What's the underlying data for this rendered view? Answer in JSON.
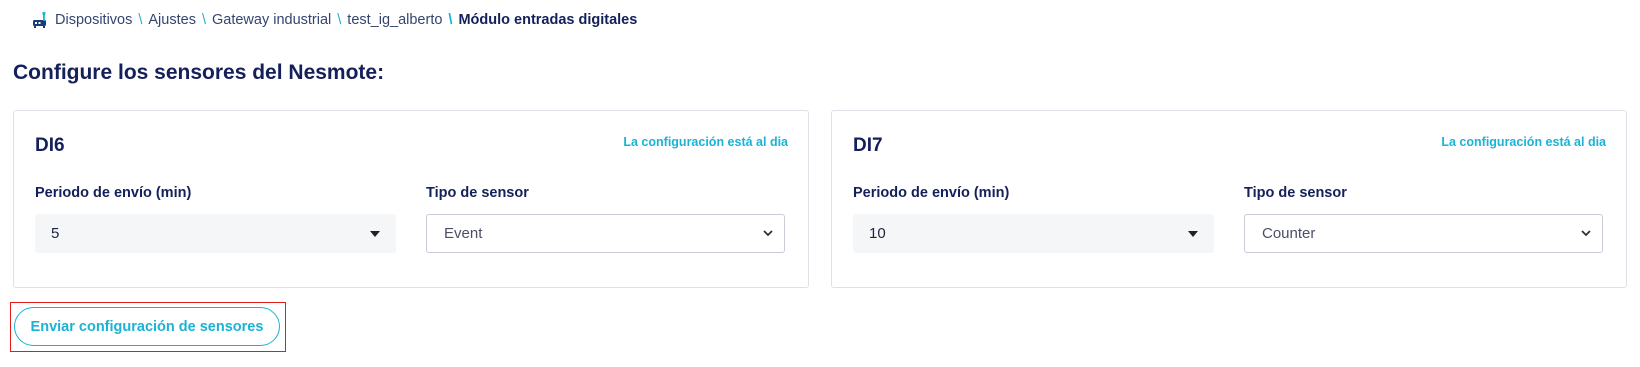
{
  "breadcrumb": {
    "items": [
      "Dispositivos",
      "Ajustes",
      "Gateway industrial",
      "test_ig_alberto"
    ],
    "current": "Módulo entradas digitales",
    "separator": "\\",
    "icon": "device-icon"
  },
  "page_title": "Configure los sensores del Nesmote:",
  "sensors": [
    {
      "name": "DI6",
      "status": "La configuración está al dia",
      "period_label": "Periodo de envío (min)",
      "period_value": "5",
      "type_label": "Tipo de sensor",
      "type_value": "Event"
    },
    {
      "name": "DI7",
      "status": "La configuración está al dia",
      "period_label": "Periodo de envío (min)",
      "period_value": "10",
      "type_label": "Tipo de sensor",
      "type_value": "Counter"
    }
  ],
  "submit_label": "Enviar configuración de sensores",
  "colors": {
    "accent": "#1ab3d6",
    "title": "#14205a",
    "highlight_border": "#e31b1b"
  }
}
